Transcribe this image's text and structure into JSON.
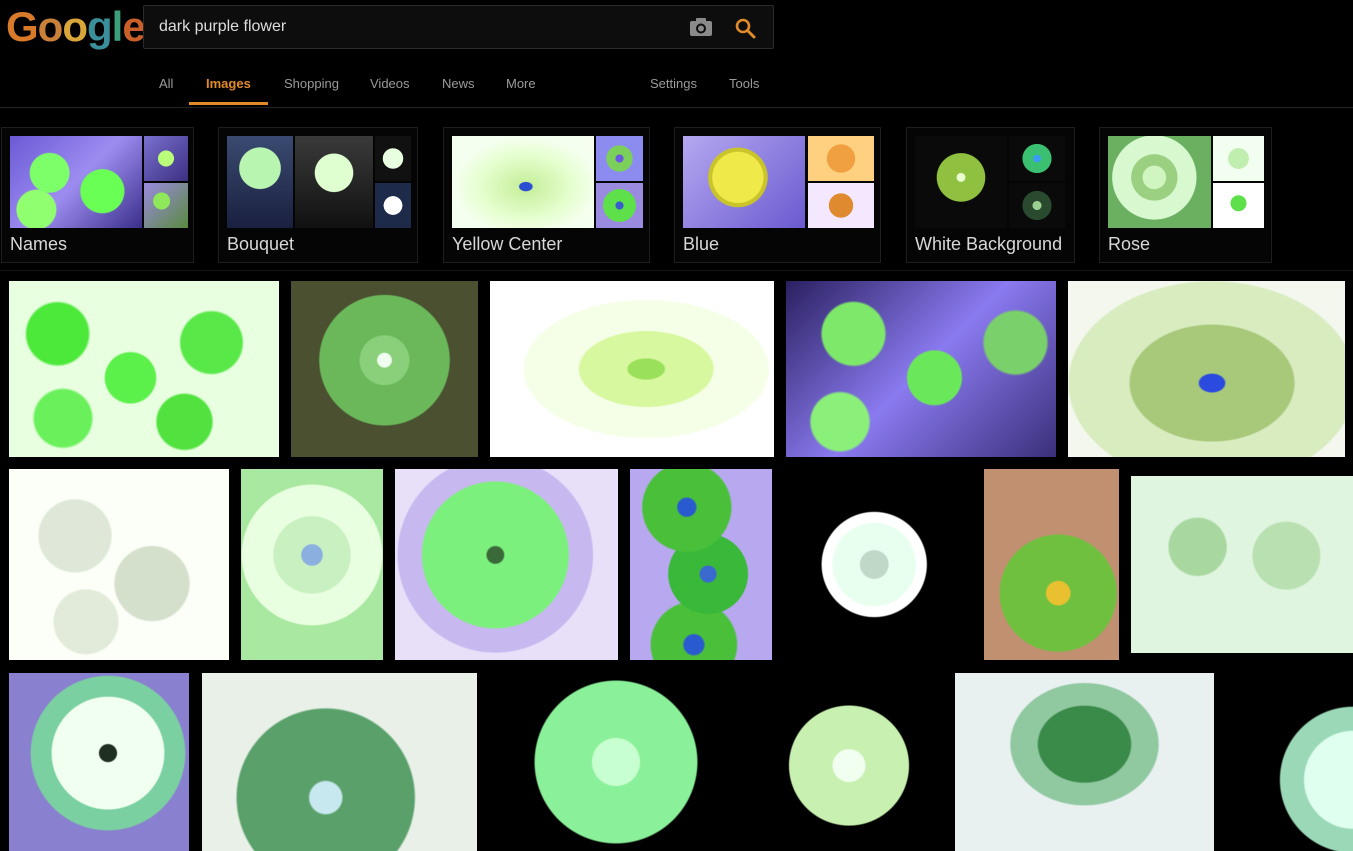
{
  "logo": {
    "letters": [
      "G",
      "o",
      "o",
      "g",
      "l",
      "e"
    ],
    "colors": [
      "#d87a2a",
      "#c9813a",
      "#d9a63a",
      "#3a8f9a",
      "#3aa07a",
      "#c9602a"
    ]
  },
  "search": {
    "query": "dark purple flower",
    "icons": [
      "camera-icon",
      "search-icon"
    ],
    "accent": "#e08a2a"
  },
  "nav": {
    "tabs": [
      "All",
      "Images",
      "Shopping",
      "Videos",
      "News",
      "More"
    ],
    "active": "Images",
    "right": [
      "Settings",
      "Tools"
    ]
  },
  "related": [
    {
      "label": "Names"
    },
    {
      "label": "Bouquet"
    },
    {
      "label": "Yellow Center"
    },
    {
      "label": "Blue"
    },
    {
      "label": "White Background"
    },
    {
      "label": "Rose"
    }
  ]
}
